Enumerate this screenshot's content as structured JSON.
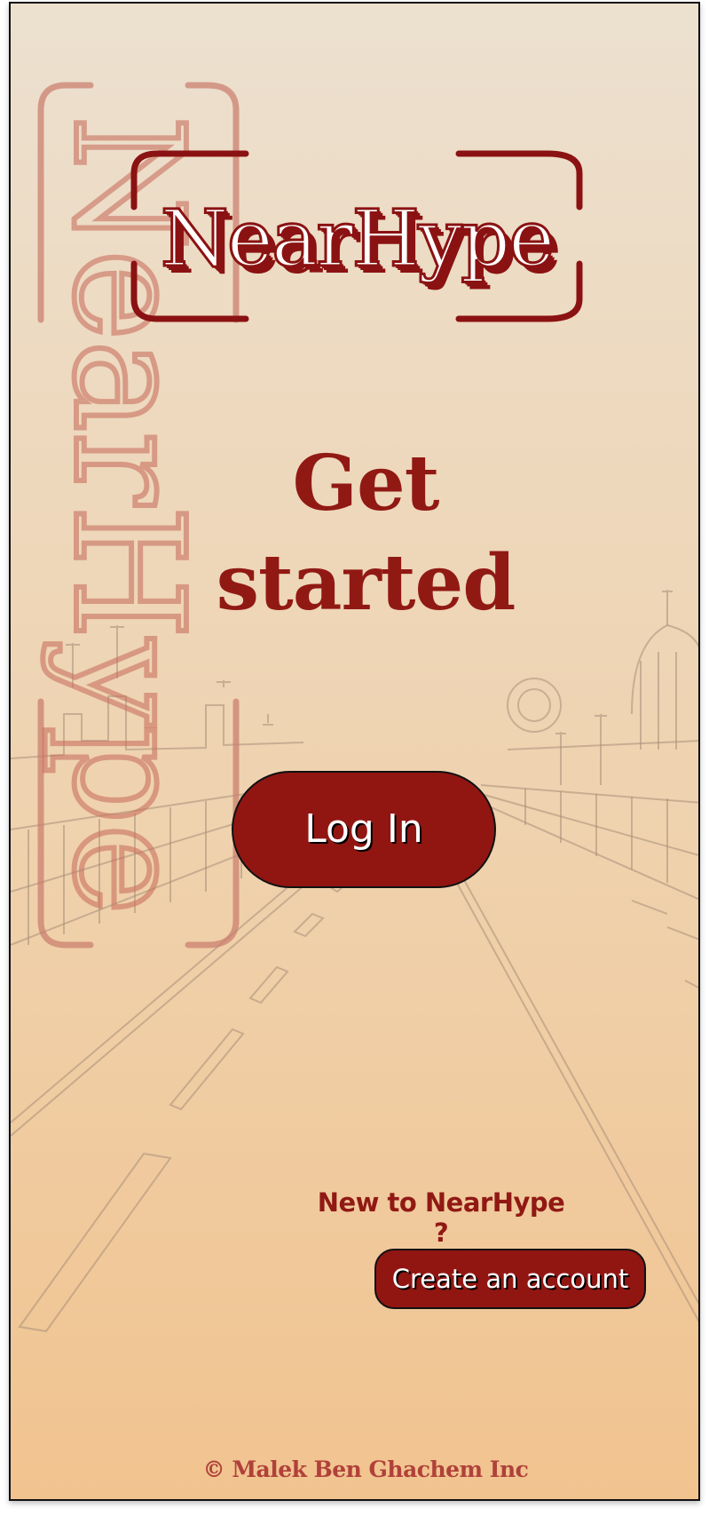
{
  "app": {
    "brand": "NearHype",
    "vertical_brand": "NearHype"
  },
  "main": {
    "headline_line1": "Get",
    "headline_line2": "started",
    "login_label": "Log In",
    "new_prompt": "New to NearHype ?",
    "create_label": "Create an account"
  },
  "footer": {
    "copyright": "© Malek Ben Ghachem Inc"
  },
  "colors": {
    "brand_red": "#911612",
    "copyright_text": "#b0413a",
    "background_top": "#ece0cf",
    "background_bottom": "#f1c38f"
  },
  "background": {
    "illustration": "sketched-bridge-road-illustration"
  }
}
